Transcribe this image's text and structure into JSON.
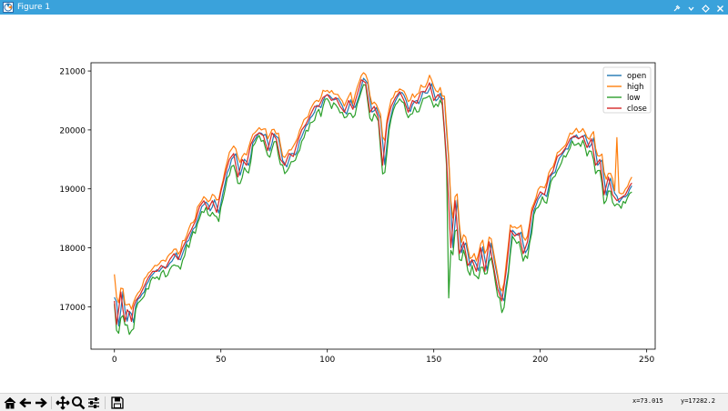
{
  "window": {
    "title": "Figure 1"
  },
  "statusbar": {
    "x_readout": "x=73.015",
    "y_readout": "y=17282.2"
  },
  "toolbar": {
    "buttons": [
      "home-icon",
      "back-arrow-icon",
      "forward-arrow-icon",
      "pan-icon",
      "zoom-icon",
      "configure-subplots-icon",
      "save-icon"
    ]
  },
  "chart_data": {
    "type": "line",
    "title": "",
    "xlabel": "",
    "ylabel": "",
    "xlim": [
      -11,
      254
    ],
    "ylim": [
      16280,
      21140
    ],
    "xticks": [
      0,
      50,
      100,
      150,
      200,
      250
    ],
    "yticks": [
      17000,
      18000,
      19000,
      20000,
      21000
    ],
    "xtick_labels": [
      "0",
      "50",
      "100",
      "150",
      "200",
      "250"
    ],
    "ytick_labels": [
      "17000",
      "18000",
      "19000",
      "20000",
      "21000"
    ],
    "grid": false,
    "legend": "top-right",
    "close_anchors": [
      [
        0,
        17100
      ],
      [
        1,
        16700
      ],
      [
        2,
        16950
      ],
      [
        3,
        17250
      ],
      [
        4,
        16950
      ],
      [
        5,
        16750
      ],
      [
        6,
        16950
      ],
      [
        7,
        16900
      ],
      [
        8,
        16750
      ],
      [
        9,
        17000
      ],
      [
        10,
        17100
      ],
      [
        12,
        17200
      ],
      [
        14,
        17350
      ],
      [
        16,
        17500
      ],
      [
        18,
        17600
      ],
      [
        20,
        17600
      ],
      [
        22,
        17700
      ],
      [
        24,
        17650
      ],
      [
        26,
        17800
      ],
      [
        28,
        17900
      ],
      [
        30,
        17800
      ],
      [
        32,
        18000
      ],
      [
        34,
        18150
      ],
      [
        36,
        18300
      ],
      [
        38,
        18450
      ],
      [
        40,
        18700
      ],
      [
        42,
        18800
      ],
      [
        44,
        18650
      ],
      [
        46,
        18800
      ],
      [
        48,
        18600
      ],
      [
        50,
        18950
      ],
      [
        52,
        19250
      ],
      [
        54,
        19500
      ],
      [
        56,
        19600
      ],
      [
        58,
        19200
      ],
      [
        60,
        19500
      ],
      [
        62,
        19400
      ],
      [
        64,
        19750
      ],
      [
        66,
        19900
      ],
      [
        68,
        19950
      ],
      [
        70,
        19900
      ],
      [
        72,
        19650
      ],
      [
        74,
        19950
      ],
      [
        76,
        19850
      ],
      [
        78,
        19500
      ],
      [
        80,
        19400
      ],
      [
        82,
        19600
      ],
      [
        84,
        19550
      ],
      [
        86,
        19800
      ],
      [
        88,
        20000
      ],
      [
        90,
        20100
      ],
      [
        92,
        20250
      ],
      [
        94,
        20400
      ],
      [
        96,
        20400
      ],
      [
        98,
        20550
      ],
      [
        100,
        20600
      ],
      [
        102,
        20500
      ],
      [
        104,
        20550
      ],
      [
        106,
        20400
      ],
      [
        108,
        20300
      ],
      [
        110,
        20500
      ],
      [
        112,
        20350
      ],
      [
        114,
        20600
      ],
      [
        116,
        20850
      ],
      [
        118,
        20800
      ],
      [
        120,
        20300
      ],
      [
        122,
        20400
      ],
      [
        124,
        20200
      ],
      [
        126,
        19400
      ],
      [
        128,
        20100
      ],
      [
        130,
        20400
      ],
      [
        132,
        20550
      ],
      [
        134,
        20650
      ],
      [
        136,
        20500
      ],
      [
        138,
        20300
      ],
      [
        140,
        20500
      ],
      [
        142,
        20450
      ],
      [
        144,
        20650
      ],
      [
        146,
        20650
      ],
      [
        148,
        20800
      ],
      [
        150,
        20500
      ],
      [
        152,
        20600
      ],
      [
        154,
        20500
      ],
      [
        156,
        19500
      ],
      [
        158,
        18000
      ],
      [
        160,
        18800
      ],
      [
        162,
        17900
      ],
      [
        164,
        18100
      ],
      [
        166,
        17700
      ],
      [
        168,
        17800
      ],
      [
        170,
        17600
      ],
      [
        172,
        18000
      ],
      [
        174,
        17600
      ],
      [
        176,
        18100
      ],
      [
        178,
        17700
      ],
      [
        180,
        17300
      ],
      [
        182,
        17100
      ],
      [
        184,
        17600
      ],
      [
        186,
        18300
      ],
      [
        188,
        18200
      ],
      [
        190,
        18250
      ],
      [
        192,
        17900
      ],
      [
        194,
        18100
      ],
      [
        196,
        18600
      ],
      [
        198,
        18800
      ],
      [
        200,
        18950
      ],
      [
        202,
        18900
      ],
      [
        204,
        19200
      ],
      [
        206,
        19300
      ],
      [
        208,
        19550
      ],
      [
        210,
        19600
      ],
      [
        212,
        19700
      ],
      [
        214,
        19850
      ],
      [
        216,
        19900
      ],
      [
        218,
        19850
      ],
      [
        220,
        19900
      ],
      [
        222,
        19700
      ],
      [
        224,
        19850
      ],
      [
        226,
        19400
      ],
      [
        228,
        19500
      ],
      [
        230,
        18900
      ],
      [
        232,
        19200
      ],
      [
        234,
        18900
      ],
      [
        236,
        18800
      ],
      [
        238,
        18850
      ],
      [
        240,
        18900
      ],
      [
        242,
        19050
      ],
      [
        243,
        19100
      ]
    ],
    "series": [
      {
        "name": "open",
        "color": "#1f77b4"
      },
      {
        "name": "high",
        "color": "#ff7f0e"
      },
      {
        "name": "low",
        "color": "#2ca02c"
      },
      {
        "name": "close",
        "color": "#d62728"
      }
    ]
  }
}
